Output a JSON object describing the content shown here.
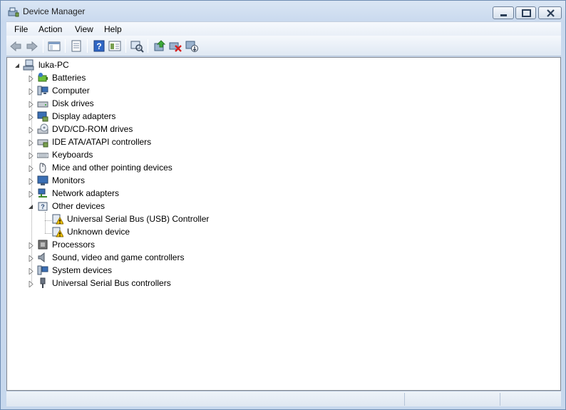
{
  "window": {
    "title": "Device Manager"
  },
  "menu": {
    "items": [
      "File",
      "Action",
      "View",
      "Help"
    ]
  },
  "toolbar": {
    "buttons": [
      "back-icon",
      "forward-icon",
      "show-hide-tree-icon",
      "properties-icon",
      "help-icon",
      "view-icon",
      "scan-hardware-icon",
      "update-driver-icon",
      "uninstall-icon",
      "disable-icon"
    ]
  },
  "tree": {
    "root": "luka-PC",
    "categories": [
      "Batteries",
      "Computer",
      "Disk drives",
      "Display adapters",
      "DVD/CD-ROM drives",
      "IDE ATA/ATAPI controllers",
      "Keyboards",
      "Mice and other pointing devices",
      "Monitors",
      "Network adapters",
      "Other devices",
      "Processors",
      "Sound, video and game controllers",
      "System devices",
      "Universal Serial Bus controllers"
    ],
    "other_devices_children": [
      "Universal Serial Bus (USB) Controller",
      "Unknown device"
    ]
  },
  "colors": {
    "accent": "#3a6ea5",
    "warning": "#f2c200"
  }
}
